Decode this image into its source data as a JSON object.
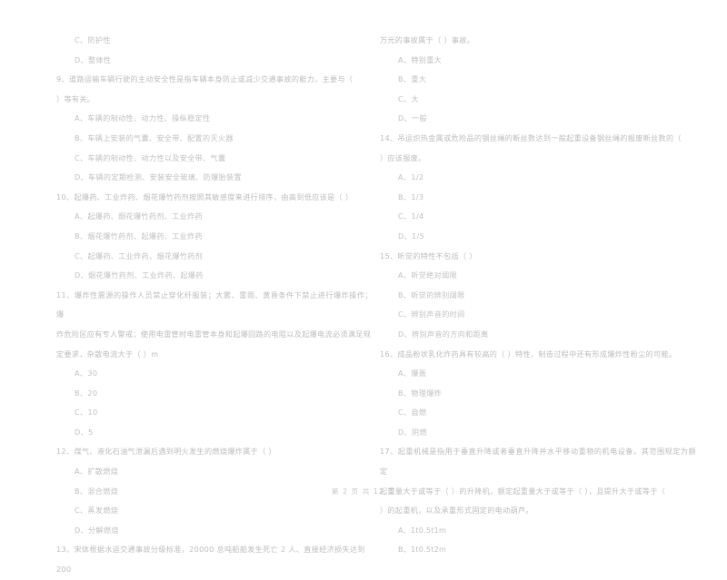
{
  "document": {
    "type": "scanned-exam-paper",
    "language": "zh-CN",
    "footer": "第 2 页 共 12 页",
    "text_color": "#bcbcbc",
    "background_color": "#ffffff"
  },
  "left_column": {
    "continued_options": [
      "C、防护性",
      "D、整体性"
    ],
    "questions": [
      {
        "number": "9",
        "stem_line1": "9、道路运输车辆行驶的主动安全性是指车辆本身防止或减少交通事故的能力，主要与（",
        "stem_line2": "）等有关。",
        "options": [
          "A、车辆的制动性、动力性、操纵稳定性",
          "B、车辆上安装的气囊、安全带、配置的灭火器",
          "C、车辆的制动性、动力性以及安全带、气囊",
          "D、车辆的定期检测、安装安全玻璃、防爆胎装置"
        ]
      },
      {
        "number": "10",
        "stem_line1": "10、起爆药、工业炸药、烟花爆竹药剂按照其敏感度来进行排序，由高到低应该是（     ）",
        "options": [
          "A、起爆药、烟花爆竹药剂、工业炸药",
          "B、烟花爆竹药剂、起爆药、工业炸药",
          "C、起爆药、工业炸药、烟花爆竹药剂",
          "D、烟花爆竹药剂、工业炸药、起爆药"
        ]
      },
      {
        "number": "11",
        "stem_line1": "11、爆炸性震源的操作人员禁止穿化纤服装；大雾、雷雨、黄昏条件下禁止进行爆炸操作；爆",
        "stem_line2": "炸危险区应有专人警戒；使用电雷管时电雷管本身和起爆回路的电阻以及起爆电流必须满足规",
        "stem_line3": "定要求，杂散电流大于（     ）m",
        "options": [
          "A、30",
          "B、20",
          "C、10",
          "D、5"
        ]
      },
      {
        "number": "12",
        "stem_line1": "12、煤气、液化石油气泄漏后遇到明火发生的燃烧爆炸属于（     ）",
        "options": [
          "A、扩散燃烧",
          "B、混合燃烧",
          "C、蒸发燃烧",
          "D、分解燃烧"
        ]
      },
      {
        "number": "13",
        "stem_line1": "13、宋体根据水运交通事故分级标准，20000 总吨船舶发生死亡 2 人、直接经济损失达到 200",
        "options": []
      }
    ]
  },
  "right_column": {
    "continued_stem": "万元的事故属于（     ）事故。",
    "continued_options": [
      "A、特别重大",
      "B、重大",
      "C、大",
      "D、一般"
    ],
    "questions": [
      {
        "number": "14",
        "stem_line1": "14、吊运炽热金属或危险品的钢丝绳的断丝数达到一般起重设备钢丝绳的报废断丝数的（",
        "stem_line2": "）应该报废。",
        "options": [
          "A、1/2",
          "B、1/3",
          "C、1/4",
          "D、1/5"
        ]
      },
      {
        "number": "15",
        "stem_line1": "15、听觉的特性不包括（     ）",
        "options": [
          "A、听觉绝对阈限",
          "B、听觉的辨别阈限",
          "C、辨别声音的时间",
          "D、辨别声音的方向和距离"
        ]
      },
      {
        "number": "16",
        "stem_line1": "16、成品粉状乳化炸药具有较高的（     ）特性，制造过程中还有形成爆炸性粉尘的可能。",
        "options": [
          "A、爆轰",
          "B、物理爆炸",
          "C、自燃",
          "D、阴燃"
        ]
      },
      {
        "number": "17",
        "stem_line1": "17、起重机械是指用于垂直升降或者垂直升降并水平移动重物的机电设备。其范围规定为额定",
        "stem_line2": "起重量大于或等于（     ）的升降机，额定起重量大于或等于（     ），且提升大于或等于（",
        "stem_line3": "）的起重机，以及承重形式固定的电动葫芦。",
        "options": [
          "A、1t0.5t1m",
          "B、1t0.5t2m"
        ]
      }
    ]
  }
}
